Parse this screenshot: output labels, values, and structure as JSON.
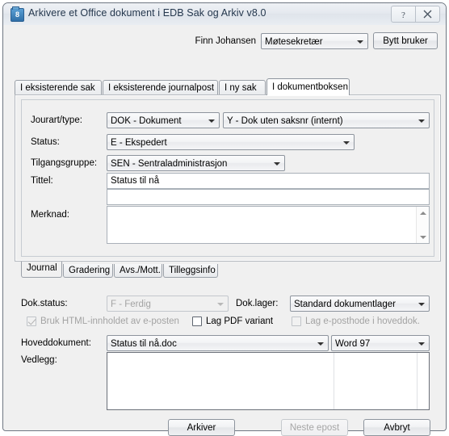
{
  "window": {
    "title": "Arkivere et Office dokument i EDB Sak og Arkiv v8.0",
    "icon_label": "8",
    "help_button": "?",
    "close_button": "✕"
  },
  "header": {
    "user_name": "Finn Johansen",
    "role_value": "Møtesekretær",
    "switch_user_button": "Bytt  bruker"
  },
  "outer_tabs": [
    {
      "label": "I eksisterende sak",
      "active": false
    },
    {
      "label": "I eksisterende journalpost",
      "active": false
    },
    {
      "label": "I ny sak",
      "active": false
    },
    {
      "label": "I dokumentboksen",
      "active": true
    }
  ],
  "form": {
    "jourart_label": "Jourart/type:",
    "jourart_value": "DOK - Dokument",
    "jourtype_value": "Y - Dok uten saksnr (internt)",
    "status_label": "Status:",
    "status_value": "E - Ekspedert",
    "tilgangsgruppe_label": "Tilgangsgruppe:",
    "tilgangsgruppe_value": "SEN - Sentraladministrasjon",
    "tittel_label": "Tittel:",
    "tittel_value": "Status til nå",
    "tittel2_value": "",
    "merknad_label": "Merknad:",
    "merknad_value": ""
  },
  "inner_tabs": [
    {
      "label": "Journal",
      "active": true
    },
    {
      "label": "Gradering",
      "active": false
    },
    {
      "label": "Avs./Mott.",
      "active": false
    },
    {
      "label": "Tilleggsinfo",
      "active": false
    }
  ],
  "doc": {
    "dok_status_label": "Dok.status:",
    "dok_status_value": "F - Ferdig",
    "dok_status_disabled": true,
    "dok_lager_label": "Dok.lager:",
    "dok_lager_value": "Standard dokumentlager",
    "checkboxes": [
      {
        "label": "Bruk HTML-innholdet av e-posten",
        "checked": true,
        "disabled": true
      },
      {
        "label": "Lag PDF variant",
        "checked": false,
        "disabled": false
      },
      {
        "label": "Lag e-posthode i hoveddok.",
        "checked": false,
        "disabled": true
      }
    ],
    "hoveddokument_label": "Hoveddokument:",
    "hoveddokument_value": "Status til nå.doc",
    "format_value": "Word 97",
    "vedlegg_label": "Vedlegg:"
  },
  "footer": {
    "archive_button": "Arkiver",
    "next_mail_button": "Neste epost",
    "next_mail_disabled": true,
    "cancel_button": "Avbryt"
  }
}
